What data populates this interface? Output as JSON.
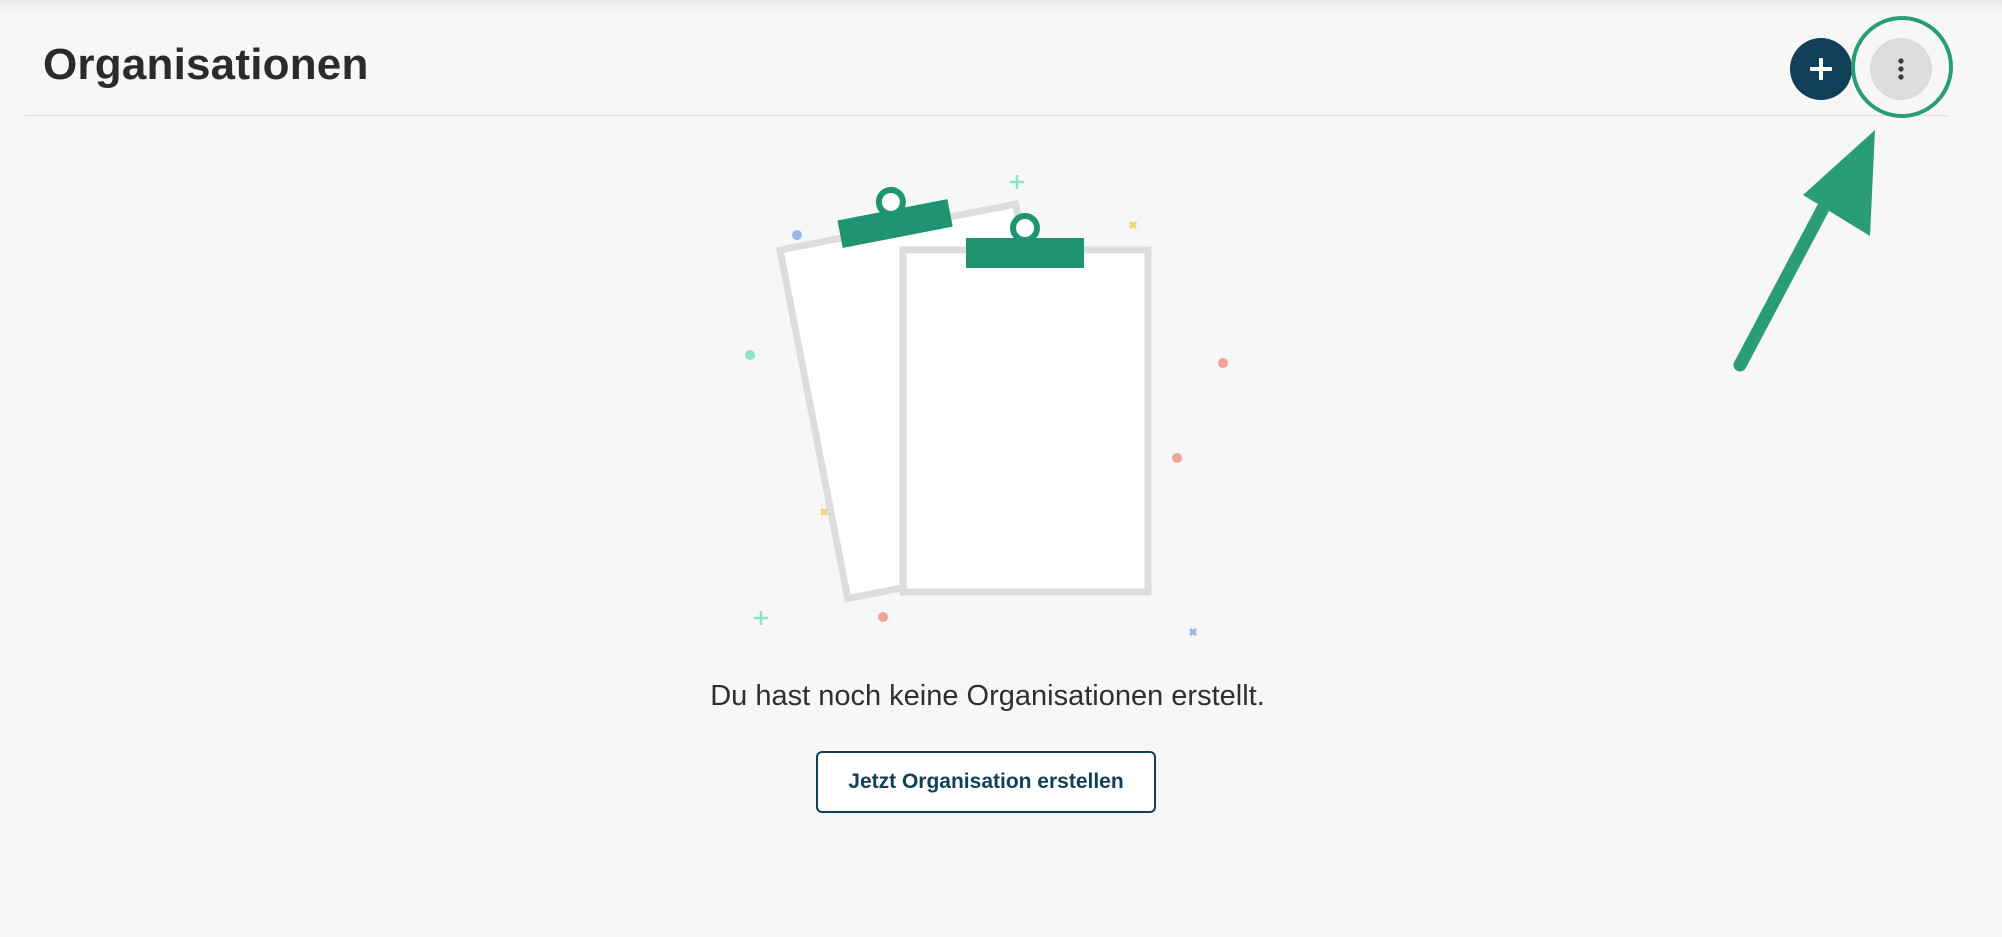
{
  "header": {
    "title": "Organisationen",
    "add_button": {
      "icon": "plus-icon",
      "aria": "+"
    },
    "more_button": {
      "icon": "more-vertical-icon"
    }
  },
  "annotation": {
    "highlight_color": "#2a9d78",
    "arrow_color": "#2a9d78"
  },
  "empty_state": {
    "illustration": "clipboards-illustration",
    "message": "Du hast noch keine Organisationen erstellt.",
    "cta_label": "Jetzt Organisation erstellen"
  },
  "colors": {
    "primary": "#123f58",
    "accent": "#1e9470",
    "background": "#f7f7f7"
  }
}
